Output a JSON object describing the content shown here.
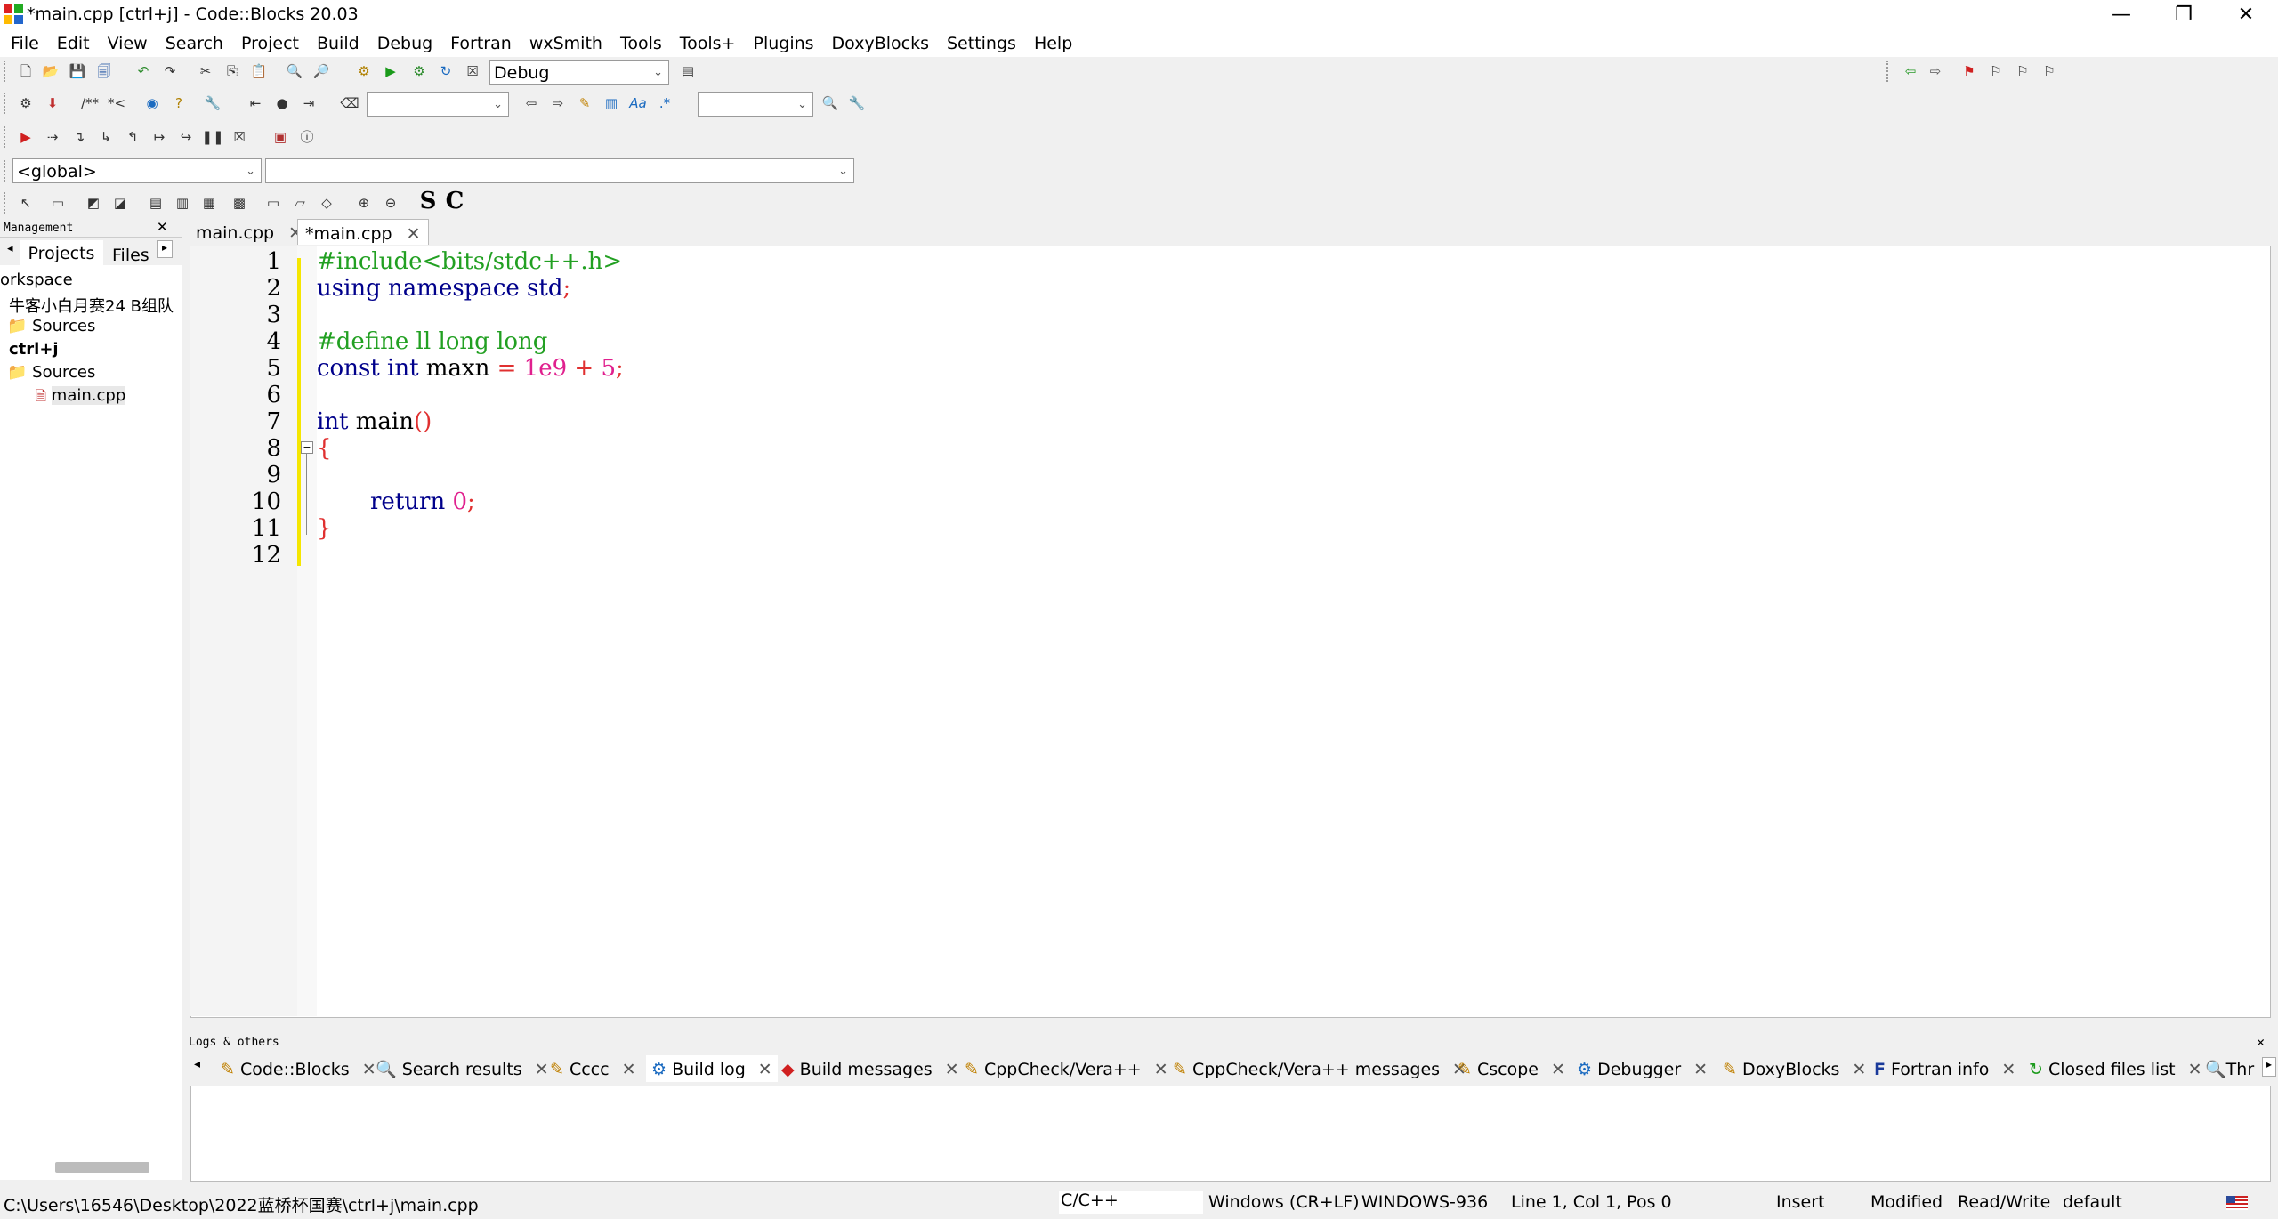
{
  "window": {
    "title": "*main.cpp [ctrl+j] - Code::Blocks 20.03"
  },
  "menu": [
    "File",
    "Edit",
    "View",
    "Search",
    "Project",
    "Build",
    "Debug",
    "Fortran",
    "wxSmith",
    "Tools",
    "Tools+",
    "Plugins",
    "DoxyBlocks",
    "Settings",
    "Help"
  ],
  "toolbar": {
    "build_target": "Debug",
    "scope_select": "<global>",
    "bold_s": "S",
    "bold_c": "C"
  },
  "management": {
    "title": "Management",
    "tabs": [
      "Projects",
      "Files"
    ],
    "tree": [
      "orkspace",
      "牛客小白月赛24 B组队",
      "Sources",
      "ctrl+j",
      "Sources",
      "main.cpp"
    ]
  },
  "editor": {
    "tabs": [
      "main.cpp",
      "*main.cpp"
    ],
    "line_numbers": [
      "1",
      "2",
      "3",
      "4",
      "5",
      "6",
      "7",
      "8",
      "9",
      "10",
      "11",
      "12"
    ],
    "code": {
      "l1": "#include<bits/stdc++.h>",
      "l2_kw": "using namespace",
      "l2_id": " std",
      "l2_op": ";",
      "l4": "#define ll long long",
      "l5_kw": "const int",
      "l5_id": " maxn ",
      "l5_op1": "=",
      "l5_num1": " 1e9 ",
      "l5_op2": "+",
      "l5_num2": " 5",
      "l5_op3": ";",
      "l7_kw": "int",
      "l7_id": " main",
      "l7_op": "()",
      "l8": "{",
      "l10_kw": "return",
      "l10_num": " 0",
      "l10_op": ";",
      "l11": "}"
    }
  },
  "logs": {
    "title": "Logs & others",
    "tabs": [
      "Code::Blocks",
      "Search results",
      "Cccc",
      "Build log",
      "Build messages",
      "CppCheck/Vera++",
      "CppCheck/Vera++ messages",
      "Cscope",
      "Debugger",
      "DoxyBlocks",
      "Fortran info",
      "Closed files list",
      "Thr"
    ]
  },
  "status": {
    "path": "C:\\Users\\16546\\Desktop\\2022蓝桥杯国赛\\ctrl+j\\main.cpp",
    "language": "C/C++",
    "eol": "Windows (CR+LF)",
    "encoding": "WINDOWS-936",
    "position": "Line 1, Col 1, Pos 0",
    "mode": "Insert",
    "modified": "Modified",
    "access": "Read/Write",
    "profile": "default"
  }
}
